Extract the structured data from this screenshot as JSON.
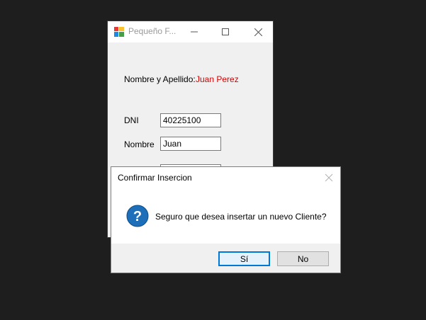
{
  "main_window": {
    "title": "Pequeño F...",
    "fields": {
      "nombre_apellido_label": "Nombre y Apellido:",
      "nombre_apellido_value": "Juan Perez",
      "dni_label": "DNI",
      "dni_value": "40225100",
      "nombre_label": "Nombre",
      "nombre_value": "Juan"
    }
  },
  "dialog": {
    "title": "Confirmar Insercion",
    "message": "Seguro que desea insertar un nuevo Cliente?",
    "yes_label": "Sí",
    "no_label": "No"
  },
  "colors": {
    "background": "#1e1e1e",
    "highlight_value": "#d40000",
    "focus_border": "#0078d7",
    "question_icon": "#1c6fb8"
  }
}
